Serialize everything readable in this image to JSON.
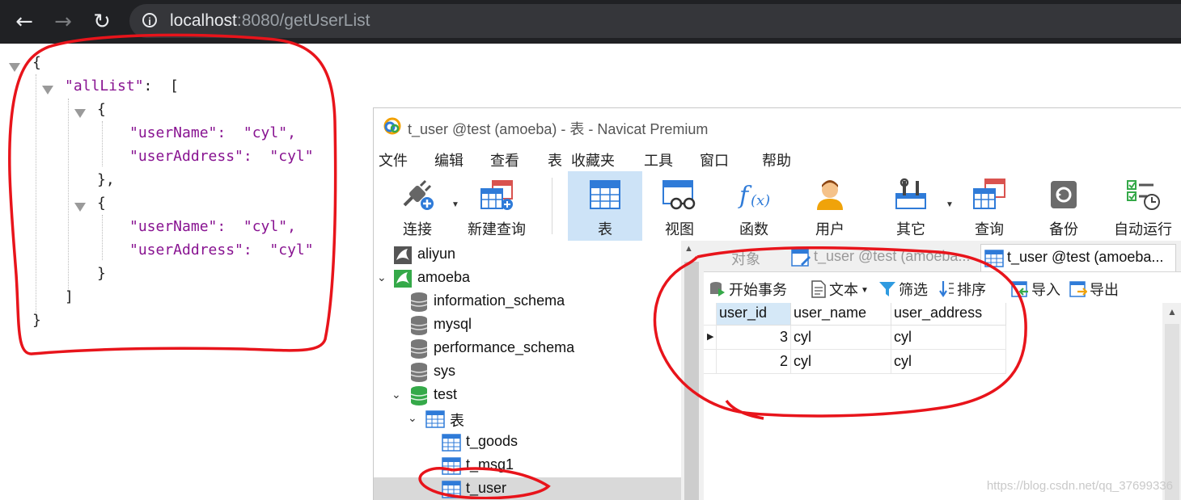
{
  "browser": {
    "url_host": "localhost",
    "url_path": ":8080/getUserList",
    "back_glyph": "←",
    "forward_glyph": "→",
    "reload_glyph": "↻",
    "info_glyph": "i"
  },
  "json_view": {
    "lines": {
      "open_root": "{",
      "allList_key": "\"allList\"",
      "allList_colon": ":  [",
      "item1_open": "{",
      "item1_name": "\"userName\":  \"cyl\",",
      "item1_addr": "\"userAddress\":  \"cyl\"",
      "item1_close": "},",
      "item2_open": "{",
      "item2_name": "\"userName\":  \"cyl\",",
      "item2_addr": "\"userAddress\":  \"cyl\"",
      "item2_close": "}",
      "array_close": "]",
      "close_root": "}"
    }
  },
  "navicat": {
    "title": "t_user @test (amoeba) - 表 - Navicat Premium",
    "menu": [
      "文件",
      "编辑",
      "查看",
      "表",
      "收藏夹",
      "工具",
      "窗口",
      "帮助"
    ],
    "toolbar": {
      "connect": "连接",
      "new_query": "新建查询",
      "table": "表",
      "view": "视图",
      "function": "函数",
      "user": "用户",
      "other": "其它",
      "query": "查询",
      "backup": "备份",
      "auto_run": "自动运行"
    },
    "tree": {
      "conn_aliyun": "aliyun",
      "conn_amoeba": "amoeba",
      "db_information_schema": "information_schema",
      "db_mysql": "mysql",
      "db_performance_schema": "performance_schema",
      "db_sys": "sys",
      "db_test": "test",
      "folder_tables": "表",
      "table_t_goods": "t_goods",
      "table_t_msg1": "t_msg1",
      "table_t_user": "t_user"
    },
    "tabs": {
      "objects": "对象",
      "tab_design": "t_user @test (amoeba...",
      "tab_data": "t_user @test (amoeba..."
    },
    "subtoolbar": {
      "begin_transaction": "开始事务",
      "text": "文本",
      "filter": "筛选",
      "sort": "排序",
      "import": "导入",
      "export": "导出"
    },
    "grid": {
      "columns": [
        "user_id",
        "user_name",
        "user_address"
      ],
      "rows": [
        [
          "3",
          "cyl",
          "cyl"
        ],
        [
          "2",
          "cyl",
          "cyl"
        ]
      ]
    }
  },
  "watermark": "https://blog.csdn.net/qq_37699336",
  "colors": {
    "browser_bar": "#202124",
    "selection": "#cde3f7",
    "annotation": "#e8141b"
  }
}
